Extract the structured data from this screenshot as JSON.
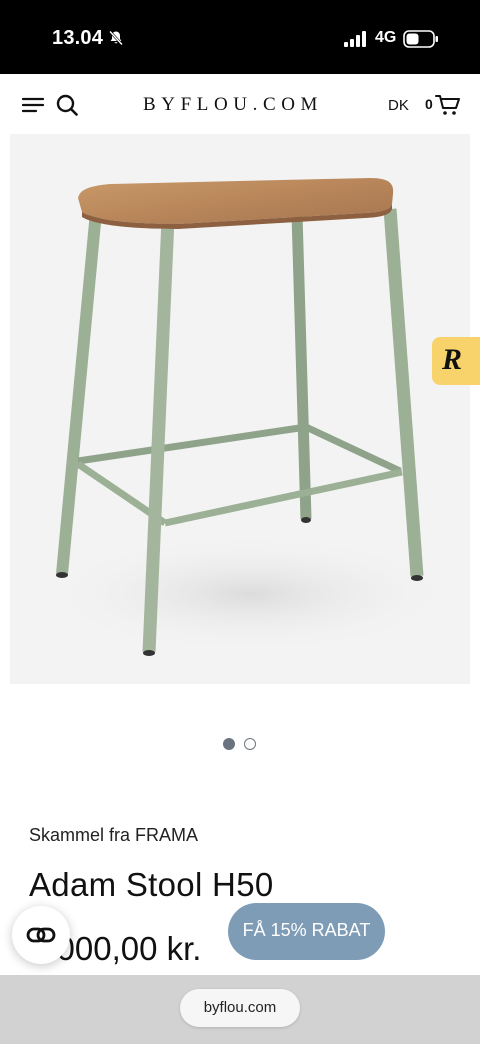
{
  "status_bar": {
    "time": "13.04",
    "network": "4G",
    "icons": [
      "bell-slash-icon",
      "signal-icon",
      "battery-icon"
    ]
  },
  "header": {
    "logo": "BYFLOU.COM",
    "language": "DK",
    "cart_count": "0",
    "icons": [
      "menu-icon",
      "search-icon",
      "cart-icon"
    ]
  },
  "gallery": {
    "image": "stool-photo",
    "current_slide": 1,
    "total_slides": 2
  },
  "review_widget": {
    "letter": "R",
    "color": "#f8d26a"
  },
  "product": {
    "brand_line": "Skammel fra FRAMA",
    "title": "Adam Stool H50",
    "price": "5.000,00 kr."
  },
  "floating": {
    "discount_label": "FÅ 15% RABAT",
    "discount_color": "#7e9cb6",
    "share_icon": "link-icon"
  },
  "browser": {
    "url": "byflou.com"
  }
}
